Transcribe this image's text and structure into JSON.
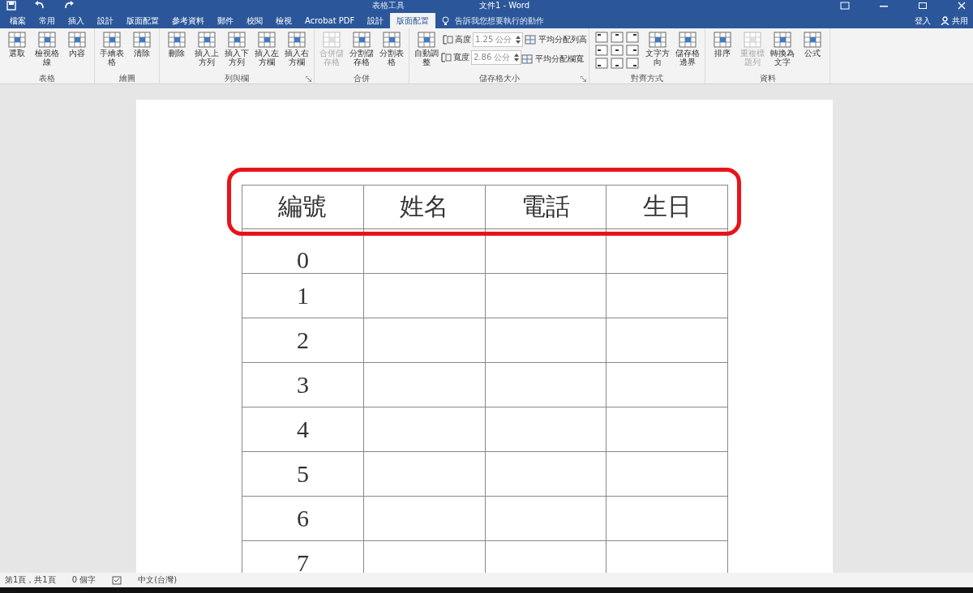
{
  "window": {
    "context_title": "表格工具",
    "title": "文件1 - Word"
  },
  "tabs": [
    {
      "label": "檔案",
      "selected": false
    },
    {
      "label": "常用",
      "selected": false
    },
    {
      "label": "插入",
      "selected": false
    },
    {
      "label": "設計",
      "selected": false
    },
    {
      "label": "版面配置",
      "selected": false
    },
    {
      "label": "參考資料",
      "selected": false
    },
    {
      "label": "郵件",
      "selected": false
    },
    {
      "label": "校閱",
      "selected": false
    },
    {
      "label": "檢視",
      "selected": false
    },
    {
      "label": "Acrobat PDF",
      "selected": false
    },
    {
      "label": "設計",
      "selected": false
    },
    {
      "label": "版面配置",
      "selected": true
    }
  ],
  "tell_me": {
    "placeholder": "告訴我您想要執行的動作"
  },
  "account": {
    "user": "登入",
    "share": "共用"
  },
  "ribbon": [
    {
      "label": "表格",
      "launcher": false,
      "items": [
        {
          "kind": "large",
          "label": "選取",
          "disabled": false
        },
        {
          "kind": "large",
          "label": "檢視格線",
          "disabled": false
        },
        {
          "kind": "large",
          "label": "內容",
          "disabled": false
        }
      ]
    },
    {
      "label": "繪圖",
      "launcher": false,
      "items": [
        {
          "kind": "large",
          "label": "手繪表格",
          "disabled": false
        },
        {
          "kind": "large",
          "label": "清除",
          "disabled": false
        }
      ]
    },
    {
      "label": "列與欄",
      "launcher": true,
      "items": [
        {
          "kind": "large",
          "label": "刪除",
          "disabled": false
        },
        {
          "kind": "large",
          "label": "插入上方列",
          "disabled": false
        },
        {
          "kind": "large",
          "label": "插入下方列",
          "disabled": false
        },
        {
          "kind": "large",
          "label": "插入左方欄",
          "disabled": false
        },
        {
          "kind": "large",
          "label": "插入右方欄",
          "disabled": false
        }
      ]
    },
    {
      "label": "合併",
      "launcher": false,
      "items": [
        {
          "kind": "large",
          "label": "合併儲存格",
          "disabled": true
        },
        {
          "kind": "large",
          "label": "分割儲存格",
          "disabled": false
        },
        {
          "kind": "large",
          "label": "分割表格",
          "disabled": false
        }
      ]
    },
    {
      "label": "儲存格大小",
      "launcher": true,
      "items": [
        {
          "kind": "large",
          "label": "自動調整",
          "disabled": false
        },
        {
          "kind": "field",
          "label": "高度",
          "value": "1.25 公分",
          "disabled": false
        },
        {
          "kind": "field",
          "label": "寬度",
          "value": "2.86 公分",
          "disabled": false
        },
        {
          "kind": "small",
          "label": "平均分配列高",
          "disabled": false
        },
        {
          "kind": "small",
          "label": "平均分配欄寬",
          "disabled": false
        }
      ]
    },
    {
      "label": "對齊方式",
      "launcher": false,
      "items": [
        {
          "kind": "grid",
          "disabled": false
        },
        {
          "kind": "large",
          "label": "文字方向",
          "disabled": false
        },
        {
          "kind": "large",
          "label": "儲存格邊界",
          "disabled": false
        }
      ]
    },
    {
      "label": "資料",
      "launcher": false,
      "items": [
        {
          "kind": "large",
          "label": "排序",
          "disabled": false
        },
        {
          "kind": "large",
          "label": "重複標題列",
          "disabled": true
        },
        {
          "kind": "large",
          "label": "轉換為文字",
          "disabled": false
        },
        {
          "kind": "large",
          "label": "公式",
          "disabled": false
        }
      ]
    }
  ],
  "table": {
    "header_highlight": true,
    "columns": [
      "編號",
      "姓名",
      "電話",
      "生日"
    ],
    "rows": [
      {
        "number": "0"
      },
      {
        "number": "1"
      },
      {
        "number": "2"
      },
      {
        "number": "3"
      },
      {
        "number": "4"
      },
      {
        "number": "5"
      },
      {
        "number": "6"
      },
      {
        "number": "7"
      }
    ]
  },
  "status_bar": [
    "第1頁，共1頁",
    "0 個字",
    "中文(台灣)"
  ]
}
